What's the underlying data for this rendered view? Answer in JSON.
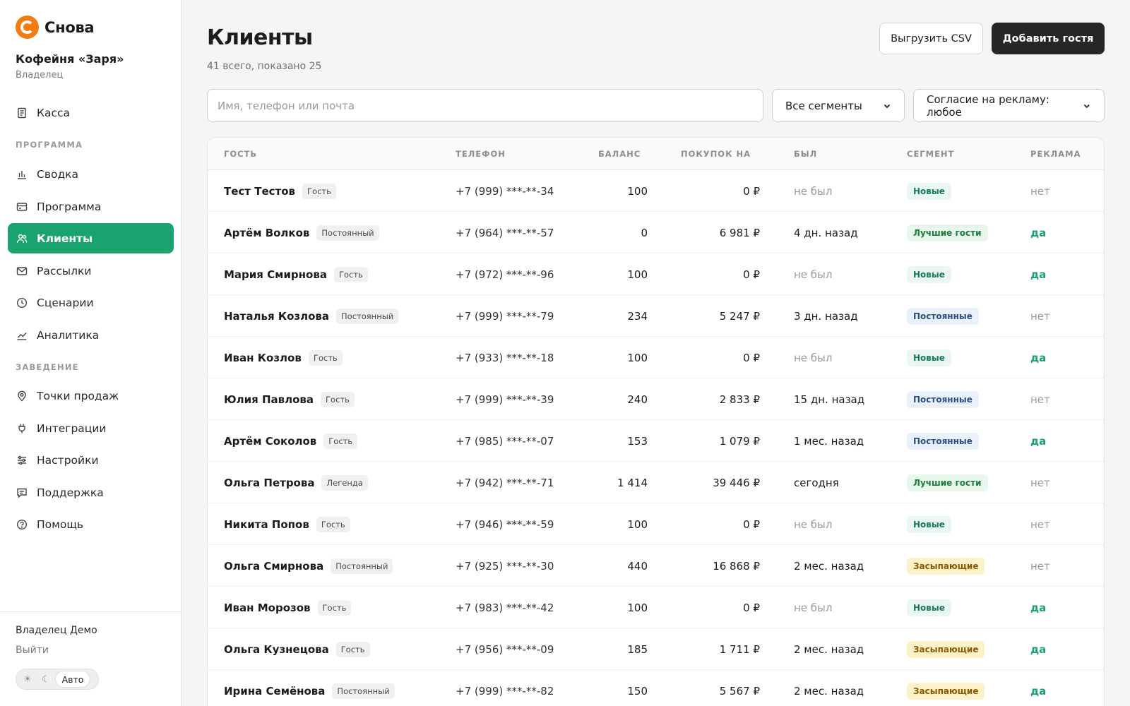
{
  "brand": {
    "name": "Снова",
    "accent": "#f07c12",
    "primary": "#1aa36f"
  },
  "venue": {
    "name": "Кофейня «Заря»",
    "role": "Владелец"
  },
  "nav": {
    "top": {
      "label": "Касса",
      "icon": "receipt-icon"
    },
    "section_program": "ПРОГРАММА",
    "program_items": [
      {
        "label": "Сводка",
        "icon": "bar-chart-icon"
      },
      {
        "label": "Программа",
        "icon": "card-icon"
      },
      {
        "label": "Клиенты",
        "icon": "users-icon",
        "active": true
      },
      {
        "label": "Рассылки",
        "icon": "mail-icon"
      },
      {
        "label": "Сценарии",
        "icon": "clock-icon"
      },
      {
        "label": "Аналитика",
        "icon": "trend-icon"
      }
    ],
    "section_venue": "ЗАВЕДЕНИЕ",
    "venue_items": [
      {
        "label": "Точки продаж",
        "icon": "location-pin-icon"
      },
      {
        "label": "Интеграции",
        "icon": "plug-icon"
      },
      {
        "label": "Настройки",
        "icon": "sliders-icon"
      },
      {
        "label": "Поддержка",
        "icon": "chat-icon"
      },
      {
        "label": "Помощь",
        "icon": "help-circle-icon"
      }
    ]
  },
  "footer": {
    "user": "Владелец Демо",
    "logout": "Выйти",
    "theme": {
      "light_icon": "☀",
      "dark_icon": "☾",
      "auto": "Авто"
    }
  },
  "page": {
    "title": "Клиенты",
    "subtitle": "41 всего, показано 25",
    "export_label": "Выгрузить CSV",
    "add_label": "Добавить гостя"
  },
  "filters": {
    "search_placeholder": "Имя, телефон или почта",
    "segment": "Все сегменты",
    "ad_consent": "Согласие на рекламу: любое"
  },
  "table": {
    "columns": [
      "ГОСТЬ",
      "ТЕЛЕФОН",
      "БАЛАНС",
      "ПОКУПОК НА",
      "БЫЛ",
      "СЕГМЕНТ",
      "РЕКЛАМА"
    ],
    "rows": [
      {
        "name": "Тест Тестов",
        "tier": "Гость",
        "phone": "+7 (999) ***-**-34",
        "balance": "100",
        "spent": "0 ₽",
        "seen": "не был",
        "segment": "Новые",
        "seg": "new",
        "ad": "нет"
      },
      {
        "name": "Артём Волков",
        "tier": "Постоянный",
        "phone": "+7 (964) ***-**-57",
        "balance": "0",
        "spent": "6 981 ₽",
        "seen": "4 дн. назад",
        "segment": "Лучшие гости",
        "seg": "best",
        "ad": "да"
      },
      {
        "name": "Мария Смирнова",
        "tier": "Гость",
        "phone": "+7 (972) ***-**-96",
        "balance": "100",
        "spent": "0 ₽",
        "seen": "не был",
        "segment": "Новые",
        "seg": "new",
        "ad": "да"
      },
      {
        "name": "Наталья Козлова",
        "tier": "Постоянный",
        "phone": "+7 (999) ***-**-79",
        "balance": "234",
        "spent": "5 247 ₽",
        "seen": "3 дн. назад",
        "segment": "Постоянные",
        "seg": "reg",
        "ad": "нет"
      },
      {
        "name": "Иван Козлов",
        "tier": "Гость",
        "phone": "+7 (933) ***-**-18",
        "balance": "100",
        "spent": "0 ₽",
        "seen": "не был",
        "segment": "Новые",
        "seg": "new",
        "ad": "да"
      },
      {
        "name": "Юлия Павлова",
        "tier": "Гость",
        "phone": "+7 (999) ***-**-39",
        "balance": "240",
        "spent": "2 833 ₽",
        "seen": "15 дн. назад",
        "segment": "Постоянные",
        "seg": "reg",
        "ad": "нет"
      },
      {
        "name": "Артём Соколов",
        "tier": "Гость",
        "phone": "+7 (985) ***-**-07",
        "balance": "153",
        "spent": "1 079 ₽",
        "seen": "1 мес. назад",
        "segment": "Постоянные",
        "seg": "reg",
        "ad": "да"
      },
      {
        "name": "Ольга Петрова",
        "tier": "Легенда",
        "phone": "+7 (942) ***-**-71",
        "balance": "1 414",
        "spent": "39 446 ₽",
        "seen": "сегодня",
        "segment": "Лучшие гости",
        "seg": "best",
        "ad": "нет"
      },
      {
        "name": "Никита Попов",
        "tier": "Гость",
        "phone": "+7 (946) ***-**-59",
        "balance": "100",
        "spent": "0 ₽",
        "seen": "не был",
        "segment": "Новые",
        "seg": "new",
        "ad": "нет"
      },
      {
        "name": "Ольга Смирнова",
        "tier": "Постоянный",
        "phone": "+7 (925) ***-**-30",
        "balance": "440",
        "spent": "16 868 ₽",
        "seen": "2 мес. назад",
        "segment": "Засыпающие",
        "seg": "sleep",
        "ad": "нет"
      },
      {
        "name": "Иван Морозов",
        "tier": "Гость",
        "phone": "+7 (983) ***-**-42",
        "balance": "100",
        "spent": "0 ₽",
        "seen": "не был",
        "segment": "Новые",
        "seg": "new",
        "ad": "да"
      },
      {
        "name": "Ольга Кузнецова",
        "tier": "Гость",
        "phone": "+7 (956) ***-**-09",
        "balance": "185",
        "spent": "1 711 ₽",
        "seen": "2 мес. назад",
        "segment": "Засыпающие",
        "seg": "sleep",
        "ad": "да"
      },
      {
        "name": "Ирина Семёнова",
        "tier": "Постоянный",
        "phone": "+7 (999) ***-**-82",
        "balance": "150",
        "spent": "5 567 ₽",
        "seen": "2 мес. назад",
        "segment": "Засыпающие",
        "seg": "sleep",
        "ad": "да"
      }
    ]
  }
}
